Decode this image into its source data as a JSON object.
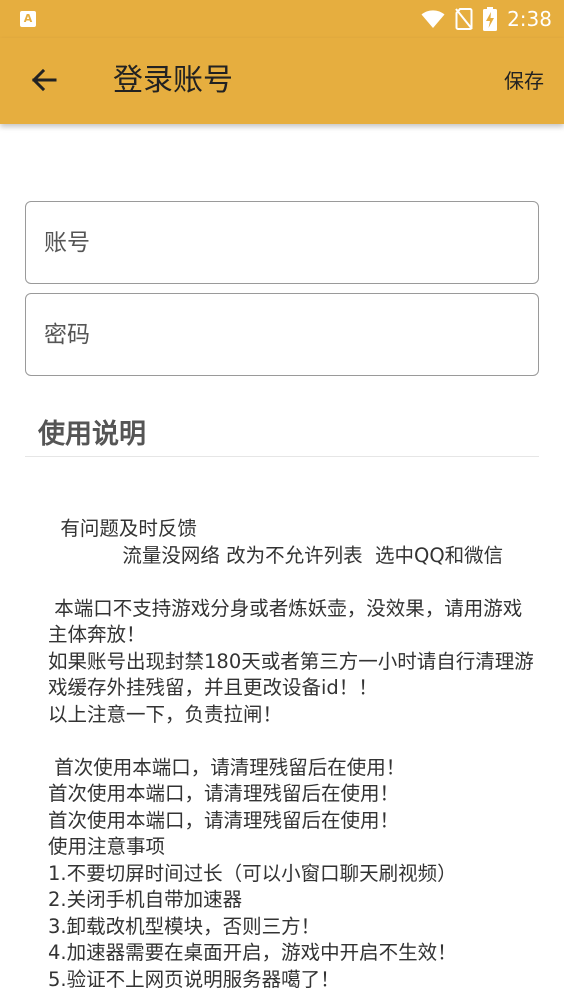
{
  "status_bar": {
    "notification_icon": "a-app-icon",
    "time": "2:38",
    "icons": [
      "wifi-icon",
      "no-sim-icon",
      "battery-charging-icon"
    ]
  },
  "app_bar": {
    "title": "登录账号",
    "save_label": "保存",
    "back_icon": "arrow-left-icon",
    "background": "#e6ae3f"
  },
  "form": {
    "account_placeholder": "账号",
    "password_placeholder": "密码"
  },
  "instructions": {
    "heading": "使用说明",
    "body": "  有问题及时反馈\n            流量没网络 改为不允许列表  选中QQ和微信\n\n 本端口不支持游戏分身或者炼妖壶，没效果，请用游戏主体奔放！\n如果账号出现封禁180天或者第三方一小时请自行清理游戏缓存外挂残留，并且更改设备id！！\n以上注意一下，负责拉闸！\n\n 首次使用本端口，请清理残留后在使用！\n首次使用本端口，请清理残留后在使用！\n首次使用本端口，请清理残留后在使用！\n使用注意事项\n1.不要切屏时间过长（可以小窗口聊天刷视频）\n2.关闭手机自带加速器\n3.卸载改机型模块，否则三方！\n4.加速器需要在桌面开启，游戏中开启不生效！\n5.验证不上网页说明服务器噶了！"
  }
}
